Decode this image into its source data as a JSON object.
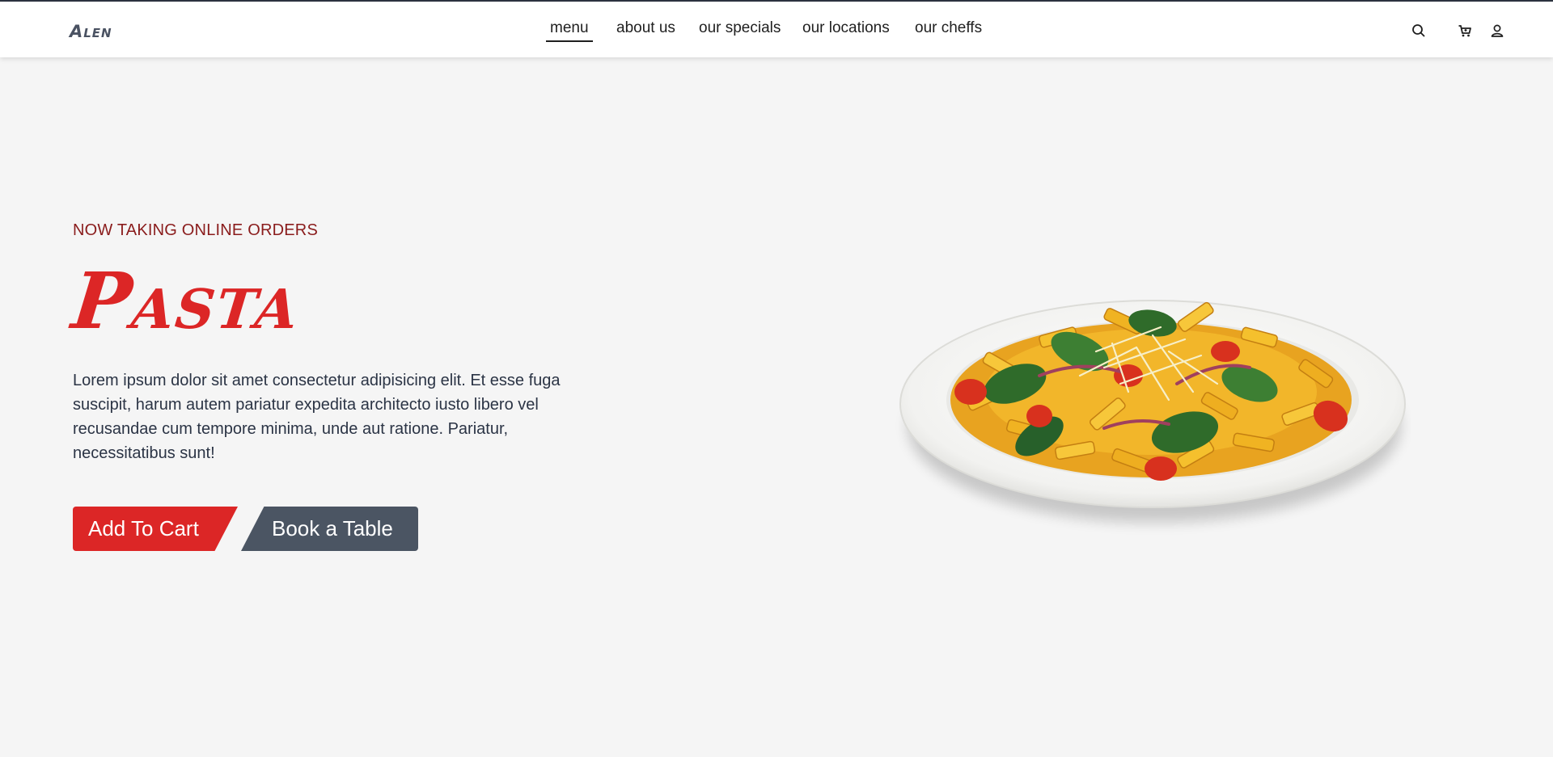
{
  "brand": {
    "logo": "Alen"
  },
  "nav": {
    "items": [
      {
        "label": "menu"
      },
      {
        "label": "about us"
      },
      {
        "label": "our specials"
      },
      {
        "label": "our locations"
      },
      {
        "label": "our cheffs"
      }
    ],
    "active_index": 0
  },
  "header_icons": [
    "search-icon",
    "cart-icon",
    "user-icon"
  ],
  "hero": {
    "tagline": "NOW TAKING ONLINE ORDERS",
    "title": "Pasta",
    "description": "Lorem ipsum dolor sit amet consectetur adipisicing elit. Et esse fuga suscipit, harum autem pariatur expedita architecto iusto libero vel recusandae cum tempore minima, unde aut ratione. Pariatur, necessitatibus sunt!",
    "primary_button": "Add To Cart",
    "secondary_button": "Book a Table"
  },
  "colors": {
    "accent": "#dc2626",
    "tagline": "#8a1c1c",
    "secondary_button": "#4b5563",
    "background": "#f5f5f5"
  }
}
